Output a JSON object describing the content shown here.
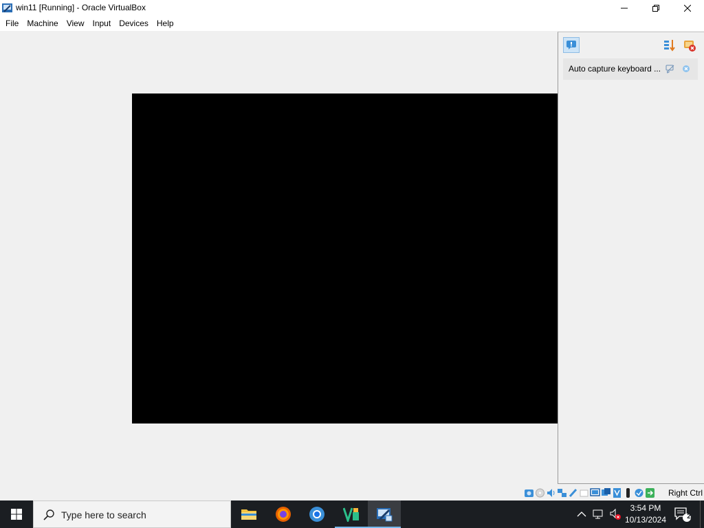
{
  "window": {
    "title": "win11 [Running] - Oracle VirtualBox"
  },
  "menu": [
    "File",
    "Machine",
    "View",
    "Input",
    "Devices",
    "Help"
  ],
  "notification_center": {
    "items": [
      {
        "text": "Auto capture keyboard ..."
      }
    ]
  },
  "statusbar": {
    "host_key": "Right Ctrl",
    "icons": [
      "hard-disk-icon",
      "optical-disk-icon",
      "audio-icon",
      "network-icon",
      "usb-icon",
      "shared-folders-icon",
      "display-icon",
      "recording-icon",
      "capture-icon",
      "mouse-integration-icon",
      "keyboard-icon",
      "arrow-icon"
    ]
  },
  "taskbar": {
    "search_placeholder": "Type here to search",
    "apps": [
      "file-explorer",
      "firefox",
      "chrome",
      "vscode-like-app",
      "virtualbox"
    ],
    "clock": {
      "time": "3:54 PM",
      "date": "10/13/2024"
    },
    "notification_count": "2"
  },
  "colors": {
    "taskbar": "#1b1e22",
    "guest_screen": "#000000",
    "accent": "#76b9ed"
  }
}
